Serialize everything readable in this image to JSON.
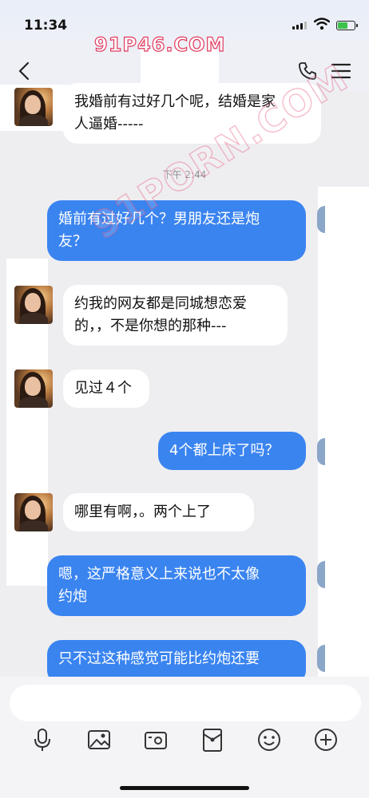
{
  "status_bar": {
    "time": "11:34"
  },
  "watermark": {
    "top": "91P46.COM",
    "diagonal": "91PORN.COM"
  },
  "chat": {
    "timestamp": "下午 2:44",
    "messages": [
      {
        "side": "in",
        "text": "我婚前有过好几个呢，结婚是家\n人逼婚-----"
      },
      {
        "side": "out",
        "text": "婚前有过好几个？男朋友还是炮\n友？"
      },
      {
        "side": "in",
        "text": "约我的网友都是同城想恋爱\n的，，不是你想的那种---"
      },
      {
        "side": "in",
        "text": "见过４个"
      },
      {
        "side": "out",
        "text": "4个都上床了吗？"
      },
      {
        "side": "in",
        "text": "哪里有啊，。两个上了"
      },
      {
        "side": "out",
        "text": "嗯，这严格意义上来说也不太像\n约炮"
      },
      {
        "side": "out",
        "text": "只不过这种感觉可能比约炮还要"
      }
    ]
  },
  "input": {
    "placeholder": ""
  },
  "toolbar": {
    "icons": [
      "microphone-icon",
      "image-icon",
      "camera-icon",
      "red-packet-icon",
      "emoji-icon",
      "plus-icon"
    ]
  },
  "colors": {
    "incoming_bubble": "#ffffff",
    "outgoing_bubble": "#3a84f0",
    "background": "#eeeef1",
    "watermark": "#e23a5e"
  }
}
